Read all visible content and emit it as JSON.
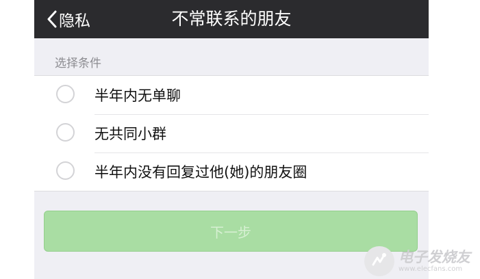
{
  "nav": {
    "back_label": "隐私",
    "title": "不常联系的朋友"
  },
  "section": {
    "header": "选择条件"
  },
  "options": [
    {
      "label": "半年内无单聊",
      "selected": false
    },
    {
      "label": "无共同小群",
      "selected": false
    },
    {
      "label": "半年内没有回复过他(她)的朋友圈",
      "selected": false
    }
  ],
  "next_button": {
    "label": "下一步",
    "enabled": false,
    "color": "#a9dda3"
  },
  "watermark": {
    "main": "电子发烧友",
    "sub": "www.elecfans.com"
  },
  "colors": {
    "nav_bg": "#2b2b2e",
    "page_bg": "#efeff4"
  }
}
